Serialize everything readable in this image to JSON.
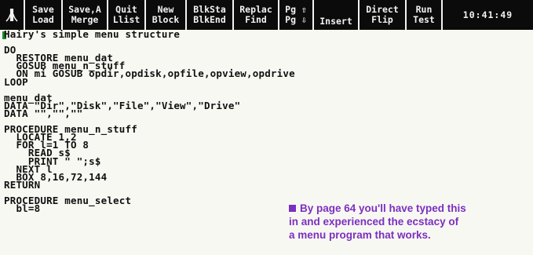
{
  "menubar": {
    "items": [
      {
        "top": "Save",
        "bottom": "Load"
      },
      {
        "top": "Save,A",
        "bottom": "Merge"
      },
      {
        "top": "Quit",
        "bottom": "Llist"
      },
      {
        "top": "New",
        "bottom": "Block"
      },
      {
        "top": "BlkSta",
        "bottom": "BlkEnd"
      },
      {
        "top": "Replac",
        "bottom": "Find"
      },
      {
        "top": "Pg ⇧",
        "bottom": "Pg ⇩"
      },
      {
        "top": "",
        "bottom": "Insert"
      },
      {
        "top": "Direct",
        "bottom": "Flip"
      },
      {
        "top": "Run",
        "bottom": "Test"
      }
    ],
    "clock": "10:41:49",
    "logo_icon": "atari-fuji-logo-icon"
  },
  "editor": {
    "lines": [
      "Hairy's simple menu structure",
      "",
      "DO",
      "  RESTORE menu_dat",
      "  GOSUB menu_n_stuff",
      "  ON mi GOSUB opdir,opdisk,opfile,opview,opdrive",
      "LOOP",
      "",
      "menu_dat",
      "DATA \"Dir\",\"Disk\",\"File\",\"View\",\"Drive\"",
      "DATA \"\",\"\",\"\"",
      "",
      "PROCEDURE menu_n_stuff",
      "  LOCATE 1,2",
      "  FOR l=1 TO 8",
      "    READ s$",
      "    PRINT \" \";s$",
      "  NEXT l",
      "  BOX 8,16,72,144",
      "RETURN",
      "",
      "PROCEDURE menu_select",
      "  bl=8"
    ],
    "cursor_color": "#1d8a2e"
  },
  "caption": {
    "lines": [
      "By page 64 you'll have typed this",
      "in and experienced the ecstacy of",
      "a menu program that works."
    ],
    "color": "#7b2fbf"
  }
}
